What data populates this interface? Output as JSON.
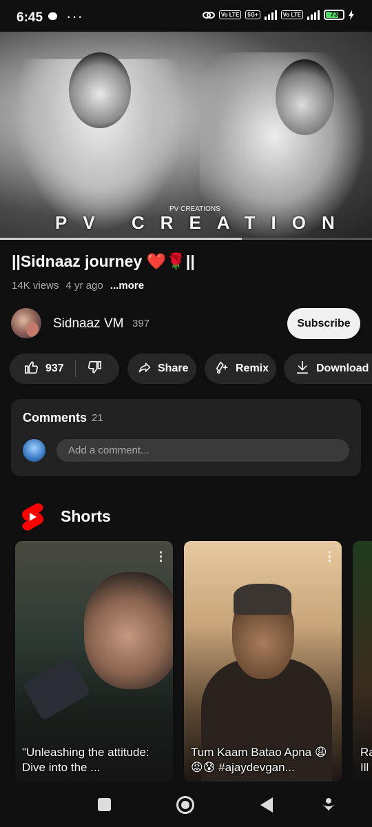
{
  "status_bar": {
    "time": "6:45",
    "dots": "···",
    "tags": [
      "Vo LTE",
      "5G+",
      "Vo LTE"
    ],
    "battery": "73"
  },
  "video": {
    "watermark_small": "PV CREATIONS",
    "watermark_big": "PV CREATION",
    "progress_fraction": 0.65
  },
  "info": {
    "title": "||Sidnaaz journey ❤️🌹||",
    "views": "14K views",
    "age": "4 yr ago",
    "more": "...more"
  },
  "channel": {
    "name": "Sidnaaz VM",
    "subscribers": "397",
    "subscribe_label": "Subscribe"
  },
  "actions": {
    "likes": "937",
    "share": "Share",
    "remix": "Remix",
    "download": "Download"
  },
  "comments": {
    "label": "Comments",
    "count": "21",
    "placeholder": "Add a comment..."
  },
  "shorts": {
    "heading": "Shorts",
    "items": [
      {
        "caption": "\"Unleashing the attitude: Dive into the ..."
      },
      {
        "caption": "Tum Kaam Batao Apna 😩😡😰 #ajaydevgan..."
      },
      {
        "caption": "Ra Ill"
      }
    ]
  },
  "colors": {
    "background": "#0f0f0f",
    "pill": "#272727",
    "card": "#212121",
    "shorts_red": "#ff0000",
    "battery_green": "#4cd964"
  }
}
